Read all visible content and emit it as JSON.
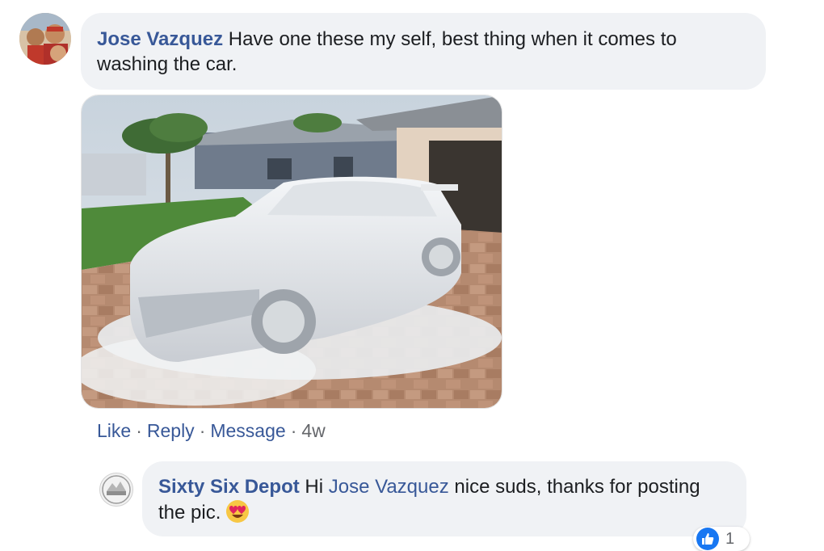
{
  "comment": {
    "author": "Jose Vazquez",
    "text": "Have one these my self, best thing when it comes to washing the car.",
    "photo": "car-covered-in-foam",
    "actions": {
      "like": "Like",
      "reply": "Reply",
      "message": "Message",
      "time": "4w",
      "separator": "·"
    }
  },
  "reply": {
    "author": "Sixty Six Depot",
    "text_before": "Hi",
    "mention": "Jose Vazquez",
    "text_after": "nice suds, thanks for posting the pic.",
    "emoji": "heart-eyes-emoji",
    "reaction_icon": "like-icon",
    "reaction_count": "1"
  },
  "colors": {
    "link": "#385898",
    "bubble": "#f0f2f5",
    "meta": "#65676b",
    "like_blue": "#1877f2"
  }
}
